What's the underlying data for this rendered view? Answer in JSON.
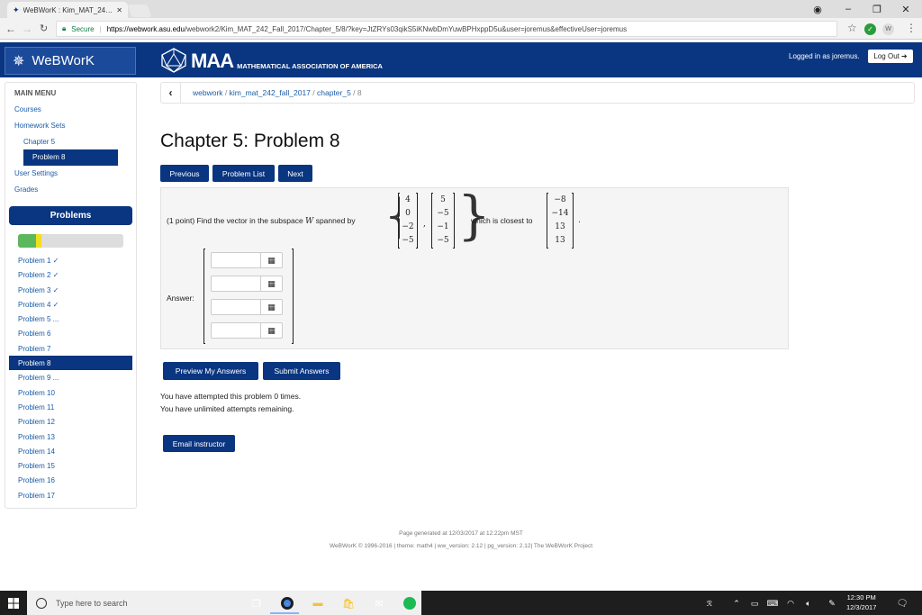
{
  "browser": {
    "tab_title": "WeBWorK : Kim_MAT_24…",
    "secure_label": "Secure",
    "url_host": "https://webwork.asu.edu",
    "url_path": "/webwork2/Kim_MAT_242_Fall_2017/Chapter_5/8/?key=JtZRYs03qikS5iKNwbDmYuwBPHxppD5u&user=joremus&effectiveUser=joremus"
  },
  "header": {
    "logo_text": "WeBWorK",
    "maa_big": "MAA",
    "maa_small": "MATHEMATICAL ASSOCIATION OF AMERICA",
    "logged_in": "Logged in as joremus.",
    "logout_label": "Log Out"
  },
  "sidebar": {
    "main_menu": "MAIN MENU",
    "courses": "Courses",
    "homework_sets": "Homework Sets",
    "chapter": "Chapter 5",
    "problem_selected": "Problem 8",
    "user_settings": "User Settings",
    "grades": "Grades",
    "problems_header": "Problems",
    "progress_correct": 0.17,
    "progress_attempted": 0.05,
    "problems": [
      "Problem 1 ✓",
      "Problem 2 ✓",
      "Problem 3 ✓",
      "Problem 4 ✓",
      "Problem 5 ...",
      "Problem 6",
      "Problem 7",
      "Problem 8",
      "Problem 9 ...",
      "Problem 10",
      "Problem 11",
      "Problem 12",
      "Problem 13",
      "Problem 14",
      "Problem 15",
      "Problem 16",
      "Problem 17"
    ]
  },
  "breadcrumb": {
    "part1": "webwork",
    "part2": "kim_mat_242_fall_2017",
    "part3": "chapter_5",
    "part4": "8",
    "sep": " / "
  },
  "main": {
    "title": "Chapter 5: Problem 8",
    "btn_previous": "Previous",
    "btn_problem_list": "Problem List",
    "btn_next": "Next",
    "problem_prefix": "(1 point) Find the vector in the subspace",
    "problem_var": "W",
    "problem_mid": "spanned by",
    "problem_suffix": "which is closest to",
    "vec1": [
      "4",
      "0",
      "−2",
      "−5"
    ],
    "vec2": [
      "5",
      "−5",
      "−1",
      "−5"
    ],
    "vec3": [
      "−8",
      "−14",
      "13",
      "13"
    ],
    "answer_label": "Answer:",
    "btn_preview": "Preview My Answers",
    "btn_submit": "Submit Answers",
    "attempts_line1": "You have attempted this problem 0 times.",
    "attempts_line2": "You have unlimited attempts remaining.",
    "btn_email": "Email instructor"
  },
  "footer": {
    "line1": "Page generated at 12/03/2017 at 12:22pm MST",
    "line2": "WeBWorK © 1996-2016 | theme: math4 | ww_version: 2.12 | pg_version: 2.12| The WeBWorK Project"
  },
  "taskbar": {
    "search_placeholder": "Type here to search",
    "time": "12:30 PM",
    "date": "12/3/2017"
  }
}
